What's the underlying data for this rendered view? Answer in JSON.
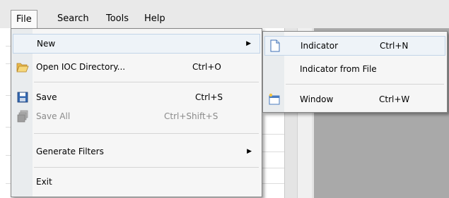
{
  "menubar": {
    "file": "File",
    "search": "Search",
    "tools": "Tools",
    "help": "Help"
  },
  "file_menu": {
    "new": {
      "label": "New"
    },
    "open": {
      "label": "Open IOC Directory...",
      "shortcut": "Ctrl+O"
    },
    "save": {
      "label": "Save",
      "shortcut": "Ctrl+S"
    },
    "save_all": {
      "label": "Save All",
      "shortcut": "Ctrl+Shift+S"
    },
    "generate_filters": {
      "label": "Generate Filters"
    },
    "exit": {
      "label": "Exit"
    }
  },
  "new_submenu": {
    "indicator": {
      "label": "Indicator",
      "shortcut": "Ctrl+N"
    },
    "indicator_from_file": {
      "label": "Indicator from File"
    },
    "window": {
      "label": "Window",
      "shortcut": "Ctrl+W"
    }
  },
  "icons": {
    "open": "folder-open-icon",
    "save": "floppy-disk-icon",
    "save_all": "multiple-floppy-icon",
    "indicator": "document-icon",
    "window": "new-window-icon",
    "submenu_arrow": "triangle-right-icon"
  }
}
